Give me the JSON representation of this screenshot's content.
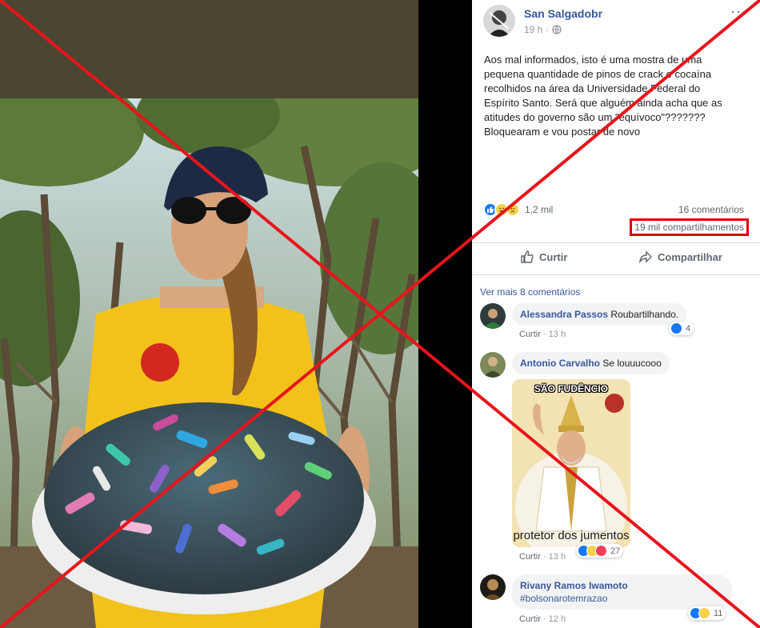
{
  "post": {
    "author": "San Salgadobr",
    "time": "19 h",
    "more_label": "···",
    "text_lines": [
      "Aos mal informados, isto é uma mostra de uma",
      "pequena quantidade de pinos de crack e cocaína",
      "recolhidos na área da Universidade Federal do",
      "Espírito Santo. Será que alguém ainda acha que as",
      "atitudes do governo são um \"equívoco\"???????",
      "Bloquearam e vou postar de novo"
    ],
    "reactions_count": "1,2 mil",
    "comments_count": "16 comentários",
    "shares_count": "19 mil compartilhamentos",
    "like_label": "Curtir",
    "share_label": "Compartilhar"
  },
  "comments_section": {
    "see_more": "Ver mais 8 comentários",
    "like_label": "Curtir",
    "items": [
      {
        "name": "Alessandra Passos",
        "text": "Roubartilhando.",
        "time": "13 h",
        "reactions": "4"
      },
      {
        "name": "Antonio Carvalho",
        "text": "Se louuucooo",
        "time": "13 h",
        "reactions": "27",
        "meme": {
          "top_text": "SÃO FUDÊNCIO",
          "bottom_text": "protetor dos jumentos"
        }
      },
      {
        "name": "Rivany Ramos Iwamoto",
        "text": "#bolsonarotemrazao",
        "time": "12 h",
        "reactions": "11"
      }
    ]
  },
  "colors": {
    "link": "#385898",
    "highlight_box": "#e00000",
    "cross": "#e8141b",
    "like_blue": "#1877f2"
  },
  "icons": [
    "globe-icon",
    "thumbs-up-icon",
    "share-arrow-icon",
    "like-reaction-icon",
    "haha-reaction-icon",
    "sad-reaction-icon",
    "love-reaction-icon",
    "more-options-icon"
  ]
}
